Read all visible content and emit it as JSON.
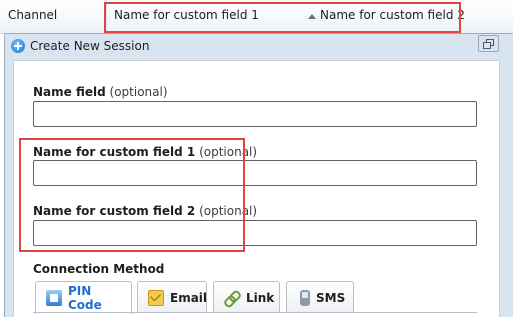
{
  "grid_header": {
    "channel": "Channel",
    "custom_field_1": "Name for custom field 1",
    "custom_field_2": "Name for custom field 2"
  },
  "dialog": {
    "title": "Create New Session",
    "fields": {
      "name": {
        "label": "Name field",
        "optional": "(optional)",
        "value": ""
      },
      "custom1": {
        "label": "Name for custom field 1",
        "optional": "(optional)",
        "value": ""
      },
      "custom2": {
        "label": "Name for custom field 2",
        "optional": "(optional)",
        "value": ""
      }
    },
    "connection_method": {
      "label": "Connection Method",
      "tabs": [
        {
          "label": "PIN Code",
          "icon": "pin-code-icon",
          "active": true
        },
        {
          "label": "Email",
          "icon": "email-icon",
          "active": false
        },
        {
          "label": "Link",
          "icon": "link-icon",
          "active": false
        },
        {
          "label": "SMS",
          "icon": "sms-icon",
          "active": false
        }
      ]
    }
  },
  "colors": {
    "highlight": "#e0443f",
    "active_tab_text": "#1f6fd1",
    "dialog_frame": "#d9e4f1"
  }
}
